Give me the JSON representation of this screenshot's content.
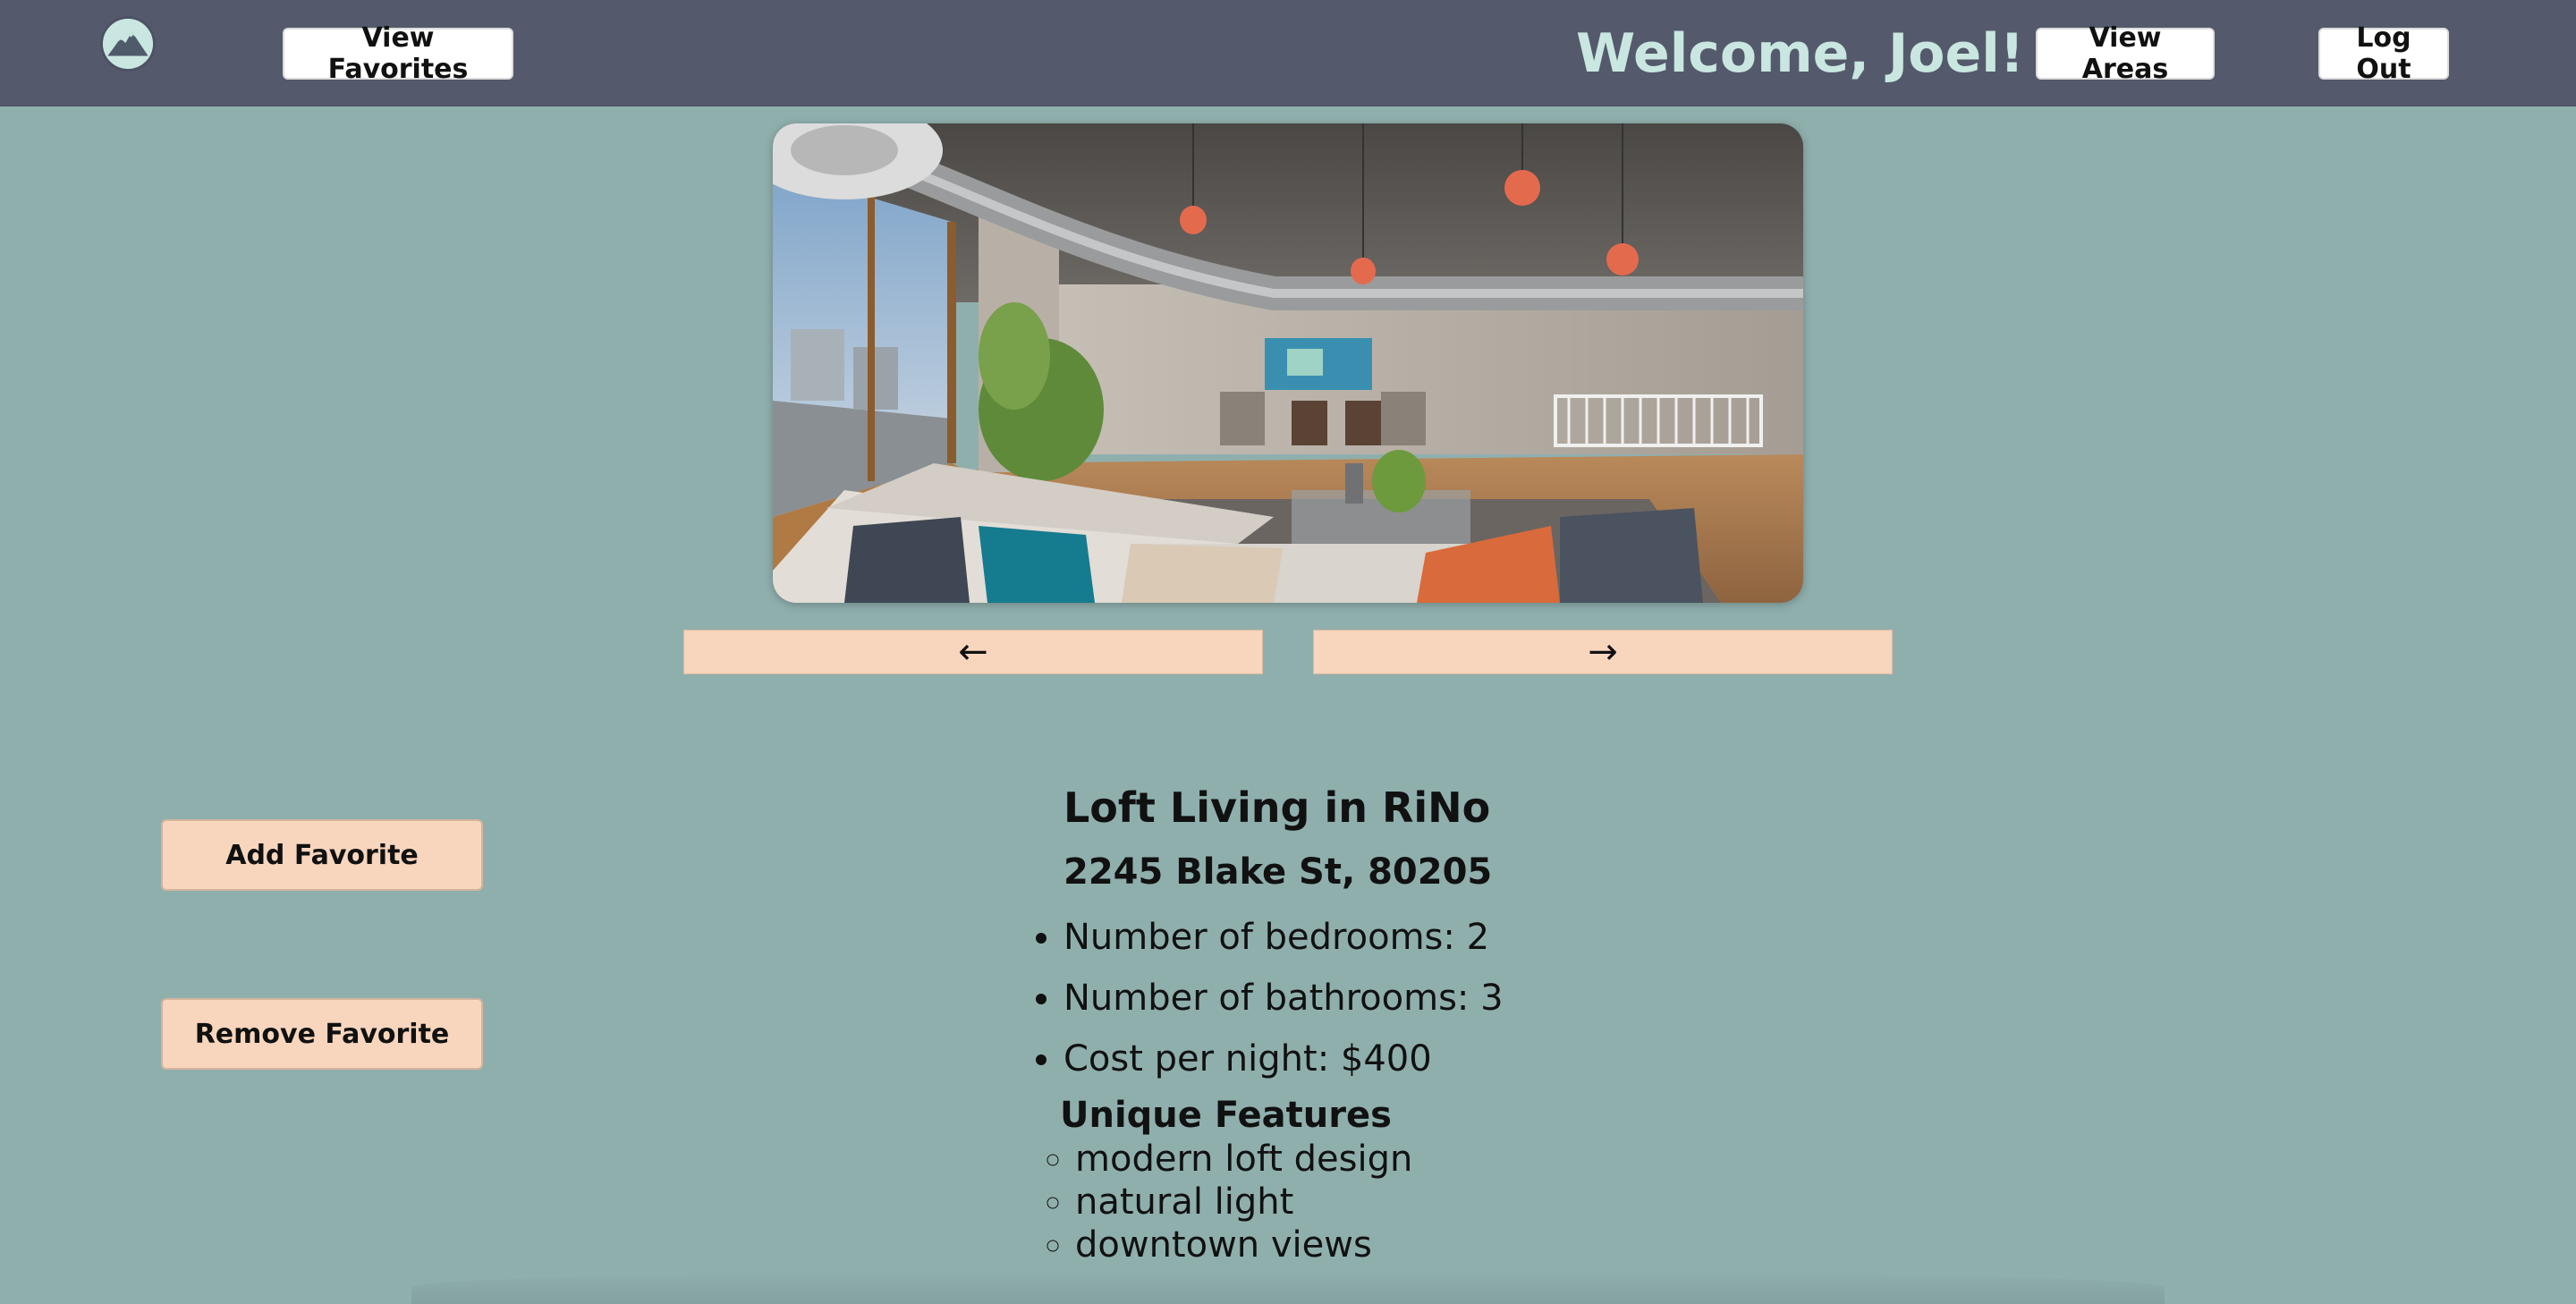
{
  "header": {
    "logo_icon": "mountain-logo-icon",
    "view_favorites_label": "View Favorites",
    "welcome_text": "Welcome, Joel!",
    "view_areas_label": "View Areas",
    "log_out_label": "Log Out"
  },
  "carousel": {
    "image_subject": "loft-living-room-photo",
    "prev_label": "←",
    "next_label": "→"
  },
  "actions": {
    "add_favorite_label": "Add Favorite",
    "remove_favorite_label": "Remove Favorite"
  },
  "listing": {
    "title": "Loft Living in RiNo",
    "address": "2245 Blake St, 80205",
    "facts": [
      "Number of bedrooms: 2",
      "Number of bathrooms: 3",
      "Cost per night: $400"
    ],
    "features_heading": "Unique Features",
    "features": [
      "modern loft design",
      "natural light",
      "downtown views"
    ]
  },
  "colors": {
    "page_background": "#8fafad",
    "header_background": "#545a6c",
    "welcome_text": "#c9e7e0",
    "action_button": "#f8d6bd"
  }
}
